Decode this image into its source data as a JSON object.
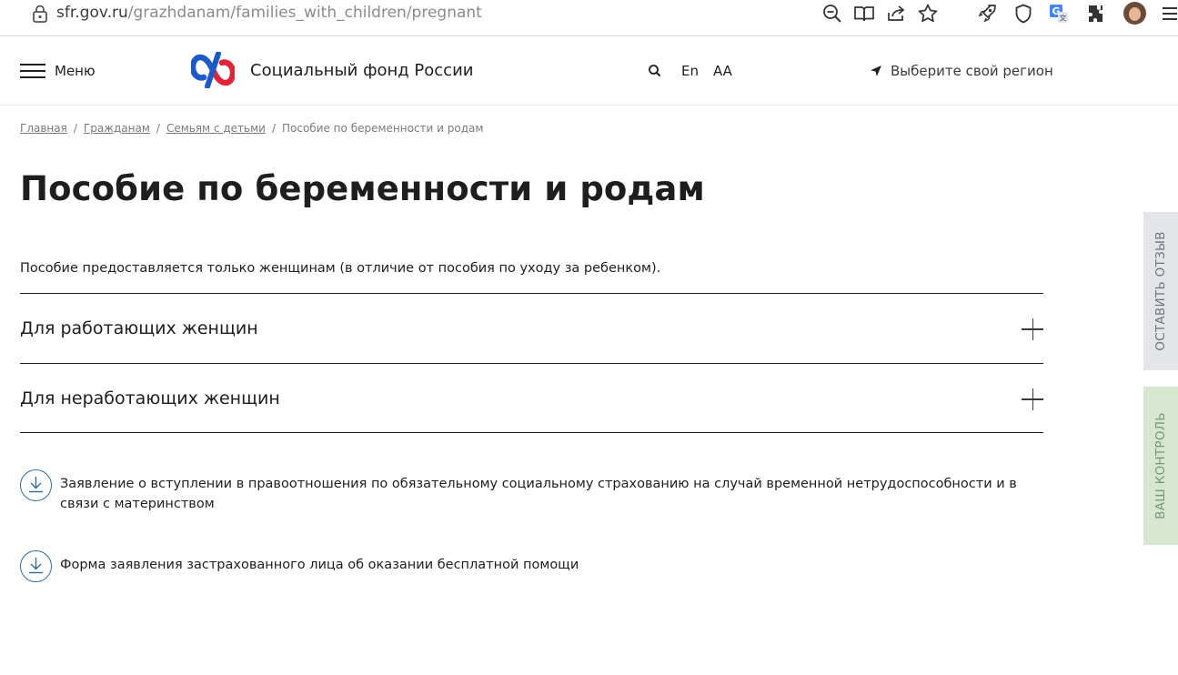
{
  "browser": {
    "url_host": "sfr.gov.ru",
    "url_path": "/grazhdanam/families_with_children/pregnant",
    "icons": [
      "lock-icon",
      "zoom-out-icon",
      "reader-view-icon",
      "share-icon",
      "bookmark-star-icon",
      "rocket-icon",
      "shield-icon",
      "translate-icon",
      "extensions-icon",
      "avatar",
      "browser-menu-icon"
    ]
  },
  "header": {
    "menu_label": "Меню",
    "brand": "Социальный фонд России",
    "lang": "En",
    "font_size": "AA",
    "region": "Выберите свой регион"
  },
  "breadcrumb": {
    "items": [
      "Главная",
      "Гражданам",
      "Семьям с детьми"
    ],
    "current": "Пособие по беременности и родам",
    "separator": "/"
  },
  "page": {
    "title": "Пособие по беременности и родам",
    "intro": "Пособие предоставляется только женщинам (в отличие от пособия по уходу за ребенком)."
  },
  "accordion": [
    {
      "title": "Для работающих женщин"
    },
    {
      "title": "Для неработающих женщин"
    }
  ],
  "documents": [
    {
      "title": "Заявление о вступлении в правоотношения по обязательному социальному страхованию на случай временной нетрудоспособности и в связи с материнством"
    },
    {
      "title": "Форма заявления застрахованного лица об оказании бесплатной помощи"
    }
  ],
  "side_tabs": {
    "feedback": "ОСТАВИТЬ ОТЗЫВ",
    "control": "ВАШ КОНТРОЛЬ"
  },
  "colors": {
    "accent_blue": "#2f6b99",
    "logo_blue": "#1d5ac8",
    "logo_red": "#e0253a",
    "feedback_tab": "#e3e5e8",
    "control_tab": "#d6e6d0"
  }
}
